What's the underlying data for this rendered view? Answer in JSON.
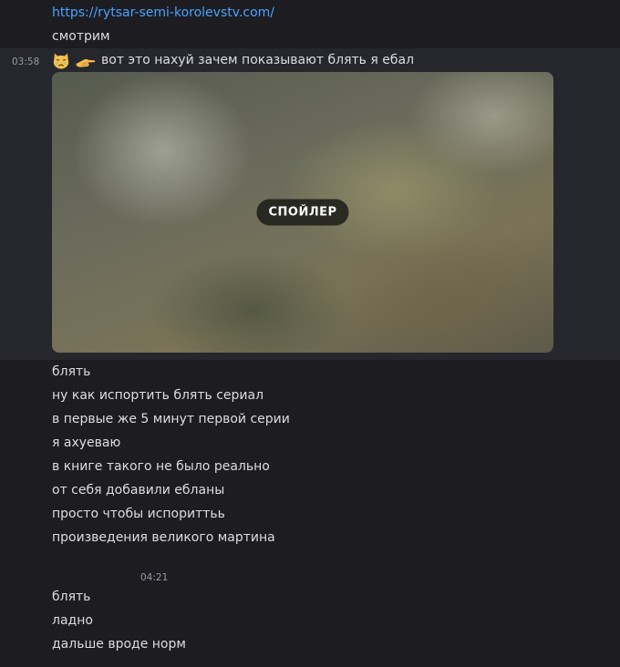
{
  "messages_before": {
    "link": "https://rytsar-semi-korolevstv.com/",
    "line2": "смотрим"
  },
  "highlighted_message": {
    "timestamp": "03:58",
    "emojis": [
      "crying-cat-emoji",
      "pointing-left-hand-emoji"
    ],
    "text": "вот это нахуй зачем показывают блять я ебал",
    "spoiler_label": "СПОЙЛЕР"
  },
  "messages_after": [
    "блять",
    "ну как испортить блять сериал",
    "в первые же 5 минут первой серии",
    "я ахуеваю",
    "в книге такого не было реально",
    "от себя добавили ебланы",
    "просто чтобы испориттьь",
    "произведения великого мартина"
  ],
  "second_group": {
    "timestamp": "04:21",
    "lines": [
      "блять",
      "ладно",
      "дальше вроде норм"
    ]
  },
  "colors": {
    "background": "#1c1c21",
    "highlight": "#26262d",
    "link": "#4aa3ff",
    "text": "#dcdde1",
    "timestamp": "#949ba4"
  }
}
